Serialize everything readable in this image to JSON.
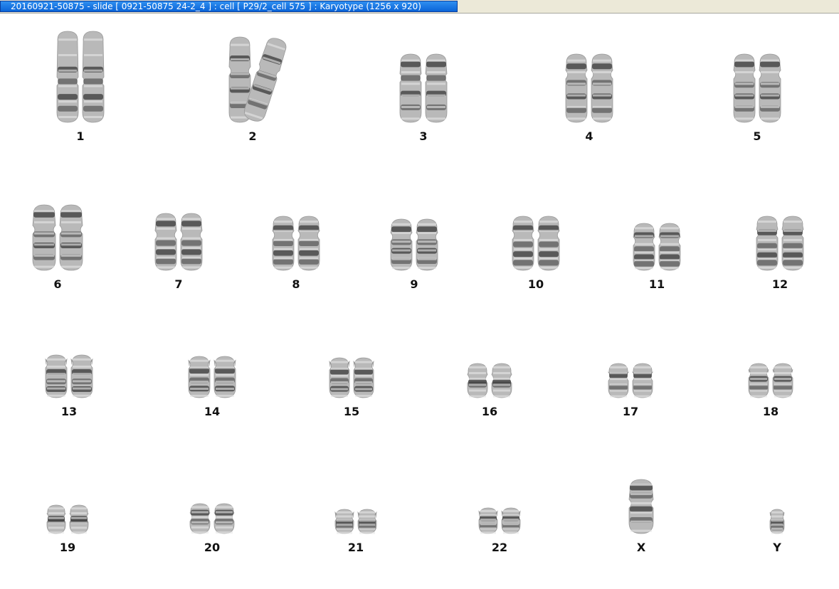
{
  "window": {
    "title": "20160921-50875 - slide [ 0921-50875 24-2_4 ] : cell [ P29/2_cell 575 ] : Karyotype  (1256 x 920)"
  },
  "karyotype": {
    "labels": [
      "1",
      "2",
      "3",
      "4",
      "5",
      "6",
      "7",
      "8",
      "9",
      "10",
      "11",
      "12",
      "13",
      "14",
      "15",
      "16",
      "17",
      "18",
      "19",
      "20",
      "21",
      "22",
      "X",
      "Y"
    ]
  },
  "colors": {
    "title_bar": "#0a64d8",
    "chromosome": "#3a3a3a",
    "background": "#ffffff"
  }
}
